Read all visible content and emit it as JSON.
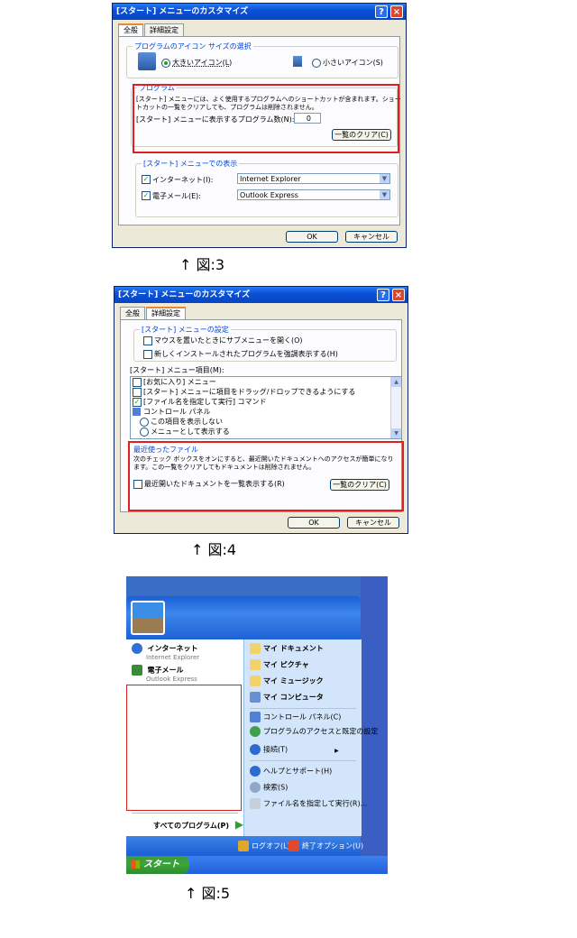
{
  "dialog1": {
    "title": "[スタート] メニューのカスタマイズ",
    "tabs": [
      "全般",
      "詳細設定"
    ],
    "icon_group": {
      "title": "プログラムのアイコン サイズの選択",
      "large": "大きいアイコン(L)",
      "small": "小さいアイコン(S)"
    },
    "programs_group": {
      "title": "プログラム",
      "desc1": "[スタート] メニューには、よく使用するプログラムへのショートカットが含まれます。ショー",
      "desc2": "トカットの一覧をクリアしても、プログラムは削除されません。",
      "count_label": "[スタート] メニューに表示するプログラム数(N):",
      "count_value": "0",
      "clear_button": "一覧のクリア(C)"
    },
    "show_group": {
      "title": "[スタート] メニューでの表示",
      "internet_label": "インターネット(I):",
      "internet_value": "Internet Explorer",
      "email_label": "電子メール(E):",
      "email_value": "Outlook Express"
    },
    "ok": "OK",
    "cancel": "キャンセル"
  },
  "caption1": "↑ 図:3",
  "dialog2": {
    "title": "[スタート] メニューのカスタマイズ",
    "tabs": [
      "全般",
      "詳細設定"
    ],
    "settings_group": {
      "title": "[スタート] メニューの設定",
      "opt1": "マウスを置いたときにサブメニューを開く(O)",
      "opt2": "新しくインストールされたプログラムを強調表示する(H)"
    },
    "items_label": "[スタート] メニュー項目(M):",
    "items": [
      {
        "text": "[お気に入り] メニュー",
        "kind": "check",
        "checked": false
      },
      {
        "text": "[スタート] メニューに項目をドラッグ/ドロップできるようにする",
        "kind": "check",
        "checked": false
      },
      {
        "text": "[ファイル名を指定して実行] コマンド",
        "kind": "check",
        "checked": true
      },
      {
        "text": "コントロール パネル",
        "kind": "folder",
        "checked": false
      },
      {
        "text": "この項目を表示しない",
        "kind": "radio",
        "checked": false
      },
      {
        "text": "メニューとして表示する",
        "kind": "radio",
        "checked": false
      }
    ],
    "recent_group": {
      "title": "最近使ったファイル",
      "desc1": "次のチェック ボックスをオンにすると、最近開いたドキュメントへのアクセスが簡単になり",
      "desc2": "ます。この一覧をクリアしてもドキュメントは削除されません。",
      "list_label": "最近開いたドキュメントを一覧表示する(R)",
      "clear_button": "一覧のクリア(C)"
    },
    "ok": "OK",
    "cancel": "キャンセル"
  },
  "caption2": "↑ 図:4",
  "startmenu": {
    "pinned": [
      {
        "title": "インターネット",
        "sub": "Internet Explorer",
        "color": "#2f6fd6"
      },
      {
        "title": "電子メール",
        "sub": "Outlook Express",
        "color": "#3a8a3a"
      }
    ],
    "all_programs": "すべてのプログラム(P)",
    "right_items": [
      "マイ ドキュメント",
      "マイ ピクチャ",
      "マイ ミュージック",
      "マイ コンピュータ",
      "コントロール パネル(C)",
      "プログラムのアクセスと既定の設定",
      "接続(T)",
      "ヘルプとサポート(H)",
      "検索(S)",
      "ファイル名を指定して実行(R)..."
    ],
    "logoff": "ログオフ(L)",
    "shutdown": "終了オプション(U)",
    "start_label": "スタート"
  },
  "caption3": "↑ 図:5"
}
